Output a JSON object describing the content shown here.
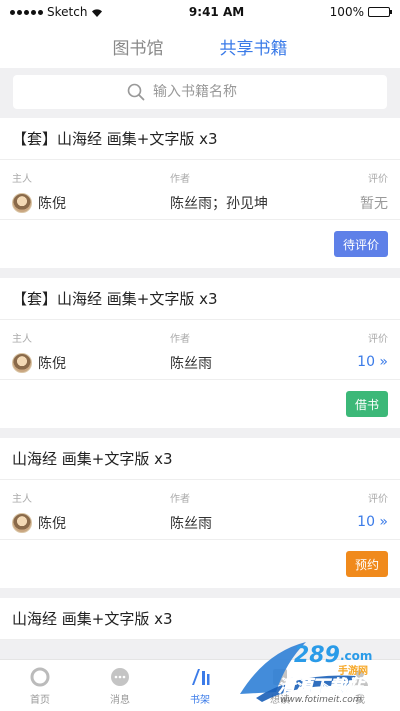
{
  "status_bar": {
    "carrier": "Sketch",
    "time": "9:41 AM",
    "battery": "100%"
  },
  "tabs": [
    {
      "label": "图书馆",
      "active": false
    },
    {
      "label": "共享书籍",
      "active": true
    }
  ],
  "search": {
    "placeholder": "输入书籍名称"
  },
  "labels": {
    "owner": "主人",
    "author": "作者",
    "rating": "评价"
  },
  "books": [
    {
      "title": "【套】山海经 画集+文字版 x3",
      "owner": "陈倪",
      "author": "陈丝雨；孙见坤",
      "rating": "暂无",
      "action": "待评价"
    },
    {
      "title": "【套】山海经 画集+文字版 x3",
      "owner": "陈倪",
      "author": "陈丝雨",
      "rating": "10 »",
      "action": "借书"
    },
    {
      "title": "山海经 画集+文字版 x3",
      "owner": "陈倪",
      "author": "陈丝雨",
      "rating": "10 »",
      "action": "预约"
    },
    {
      "title": "山海经 画集+文字版 x3"
    }
  ],
  "bottom_nav": [
    {
      "label": "首页",
      "icon": "home-icon",
      "active": false
    },
    {
      "label": "消息",
      "icon": "message-icon",
      "active": false
    },
    {
      "label": "书架",
      "icon": "bookshelf-icon",
      "active": true
    },
    {
      "label": "想读",
      "icon": "wishlist-icon",
      "active": false
    },
    {
      "label": "我",
      "icon": "profile-icon",
      "active": false
    }
  ],
  "watermark": {
    "brand": "清源下载站",
    "url": "www.fotimeit.com",
    "logo_text": "289.com 手游网"
  },
  "colors": {
    "accent": "#3b7be8",
    "review_btn": "#5e80e8",
    "borrow_btn": "#3cb878",
    "reserve_btn": "#f08a1c"
  }
}
